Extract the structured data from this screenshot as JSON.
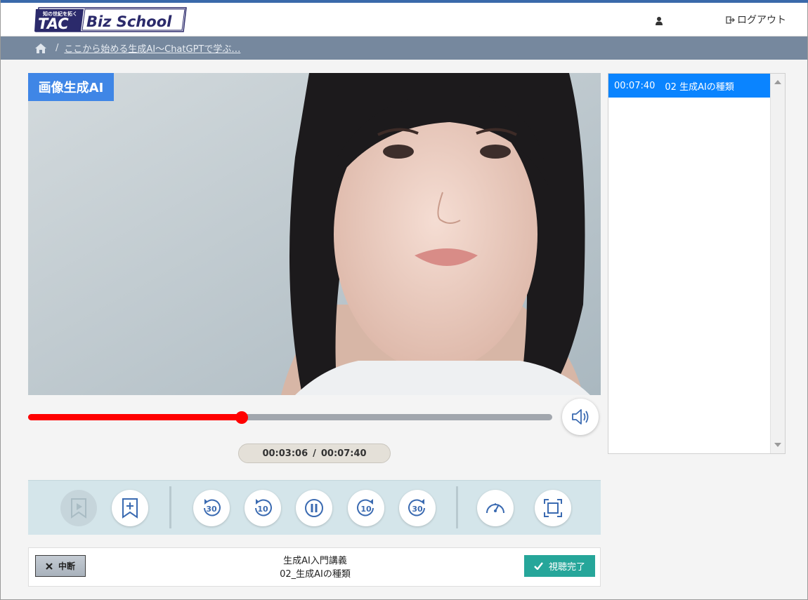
{
  "header": {
    "logo": {
      "tagline": "知の世紀を拓く",
      "brand_primary": "TAC",
      "brand_secondary": "Biz School"
    },
    "user_icon": "user-icon",
    "logout_label": "ログアウト",
    "logout_icon": "logout-icon",
    "accent_color": "#3a69aa"
  },
  "breadcrumb": {
    "home_icon": "home-icon",
    "separator": "/",
    "course_link": "ここから始める生成AI～ChatGPTで学ぶ…",
    "background_color": "#76889e"
  },
  "video": {
    "tag_label": "画像生成AI",
    "tag_color": "#3f86e6"
  },
  "player": {
    "progress_fraction": 0.408,
    "progress_color": "#ff0000",
    "current_time": "00:03:06",
    "time_separator": "/",
    "total_time": "00:07:40",
    "volume_icon": "volume-icon",
    "controls": [
      {
        "name": "play-bookmark-button",
        "icon": "bookmark-play-icon",
        "enabled": false
      },
      {
        "name": "add-bookmark-button",
        "icon": "bookmark-plus-icon",
        "enabled": true
      },
      {
        "name": "rewind-30-button",
        "icon": "rewind-30-icon",
        "label": "30"
      },
      {
        "name": "rewind-10-button",
        "icon": "rewind-10-icon",
        "label": "10"
      },
      {
        "name": "pause-button",
        "icon": "pause-icon"
      },
      {
        "name": "forward-10-button",
        "icon": "forward-10-icon",
        "label": "10"
      },
      {
        "name": "forward-30-button",
        "icon": "forward-30-icon",
        "label": "30"
      },
      {
        "name": "speed-button",
        "icon": "speedometer-icon"
      },
      {
        "name": "fullscreen-button",
        "icon": "fullscreen-icon"
      }
    ]
  },
  "bottom": {
    "pause_label": "中断",
    "lecture_course": "生成AI入門講義",
    "lecture_chapter": "02_生成AIの種類",
    "complete_label": "視聴完了",
    "complete_color": "#26a69a"
  },
  "chapters": {
    "items": [
      {
        "time": "00:07:40",
        "title": "02 生成AIの種類",
        "active": true
      }
    ],
    "active_color": "#0a84ff"
  }
}
